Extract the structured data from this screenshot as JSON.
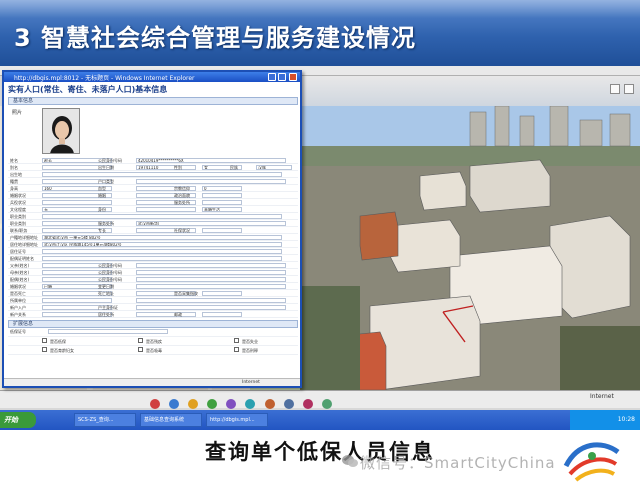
{
  "slide": {
    "title": "3 智慧社会综合管理与服务建设情况",
    "caption": "查询单个低保人员信息",
    "watermark": "微信号：SmartCityChina",
    "header_color": "#2f62ae"
  },
  "ie_window": {
    "title": "http://dbgis.mpl:8012 - 无标题页 - Windows Internet Explorer",
    "status_text": "Internet"
  },
  "form": {
    "title": "实有人口(常住、寄住、未落户人口)基本信息",
    "section_basic": "基本信息",
    "photo_label": "照片",
    "rows": [
      {
        "label": "姓名",
        "value": "赵芳",
        "label2": "公民身份号码",
        "value2": "42010419**********6X"
      },
      {
        "label": "别名",
        "value": "",
        "label2": "出生日期",
        "value2": "19741110",
        "label3": "性别",
        "value3": "女",
        "label4": "民族",
        "value4": "汉族"
      },
      {
        "label": "出生地",
        "value": ""
      },
      {
        "label": "籍贯",
        "value": "",
        "label2": "户口类型",
        "value2": ""
      },
      {
        "label": "身高",
        "value": "160",
        "label2": "血型",
        "value2": "",
        "label3": "宗教信仰",
        "value3": "0"
      },
      {
        "label": "婚姻状况",
        "value": "",
        "label2": "婚姻",
        "value2": "",
        "label3": "政治面貌",
        "value3": ""
      },
      {
        "label": "兵役状况",
        "value": "",
        "label2": "",
        "value2": "",
        "label3": "服务处所",
        "value3": ""
      },
      {
        "label": "文化程度",
        "value": "无",
        "label2": "身份",
        "value2": "",
        "label3": "",
        "value3": "未婚生活"
      },
      {
        "label": "职业类别",
        "value": ""
      },
      {
        "label": "职业类别",
        "value": "",
        "label2": "服务处所",
        "value2": "武汉市新华厂"
      },
      {
        "label": "联系/职务",
        "value": "",
        "label2": "专长",
        "value2": "",
        "label3": "社保状况",
        "value3": ""
      },
      {
        "label": "户籍地详细地址",
        "value": "湖北省武汉市 一单元5楼 802号"
      },
      {
        "label": "居住地详细地址",
        "value": "武汉市江汉区 民族路145号1单元4楼802号"
      },
      {
        "label": "居住证号",
        "value": ""
      },
      {
        "label": "配偶证明姓名",
        "value": ""
      },
      {
        "label": "父亲(姓名)",
        "value": "",
        "label2": "公民身份号码",
        "value2": ""
      },
      {
        "label": "母亲(姓名)",
        "value": "",
        "label2": "公民身份号码",
        "value2": ""
      },
      {
        "label": "配偶(姓名)",
        "value": "",
        "label2": "公民身份号码",
        "value2": ""
      },
      {
        "label": "婚姻状况",
        "value": "已婚",
        "label2": "变更日期",
        "value2": ""
      },
      {
        "label": "是否死亡",
        "value": "",
        "label2": "死亡地址",
        "value2": "",
        "label3": "是否采集指纹",
        "value3": ""
      },
      {
        "label": "所属单位",
        "value": "",
        "label2": "",
        "value2": ""
      },
      {
        "label": "新户入户",
        "value": "",
        "label2": "户主身份证",
        "value2": ""
      },
      {
        "label": "新户关系",
        "value": "",
        "label2": "居住处所",
        "value2": "",
        "label3": "邮政",
        "value3": ""
      }
    ],
    "section_ext": "扩展信息",
    "ext_label": "低保证号",
    "checks": [
      [
        "是否低保",
        "是否残疾",
        "是否失业"
      ],
      [
        "是否育龄妇女",
        "是否吸毒",
        "是否刑释"
      ]
    ]
  },
  "taskbar": {
    "start": "开始",
    "items": [
      "SCS-ZS_查询...",
      "基础信息查询系统",
      "http://dbgis.mpl..."
    ],
    "clock": "10:28"
  },
  "colors": {
    "titlebar": "#1a4fc4",
    "map_bg": "#8d8a83",
    "taskbar": "#2255c2"
  }
}
